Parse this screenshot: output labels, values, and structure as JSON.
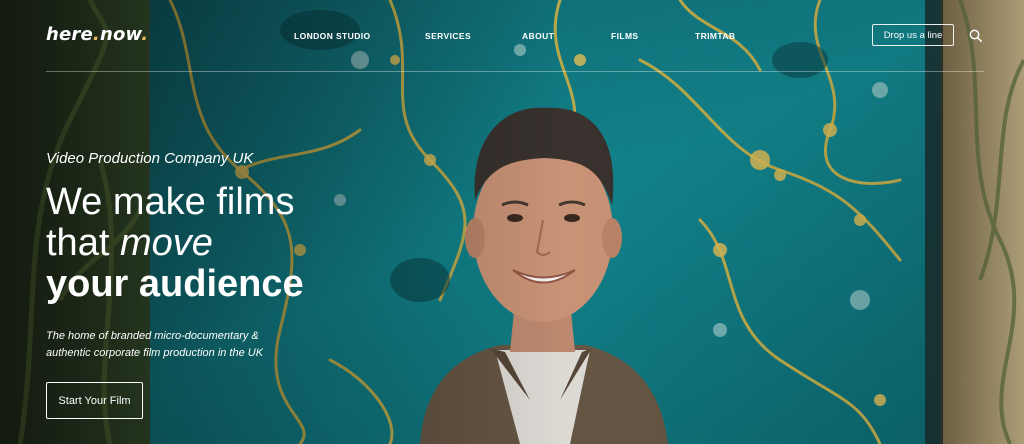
{
  "brand": {
    "name": "here",
    "dot": ".",
    "name2": "now",
    "dot2": "."
  },
  "nav": {
    "items": [
      {
        "label": "LONDON STUDIO"
      },
      {
        "label": "SERVICES"
      },
      {
        "label": "ABOUT"
      },
      {
        "label": "FILMS"
      },
      {
        "label": "TRIMTAB"
      }
    ],
    "cta_label": "Drop us a line",
    "search_icon": "search-icon"
  },
  "hero": {
    "eyebrow": "Video Production Company UK",
    "headline_line1": "We make films",
    "headline_line2_a": "that ",
    "headline_line2_b": "move",
    "headline_line3": "your audience",
    "subtitle": "The home of branded micro-documentary & authentic corporate film production in the UK",
    "button_label": "Start Your Film"
  },
  "colors": {
    "accent": "#e8b75a",
    "tapestry": "#138a93",
    "text": "#ffffff"
  }
}
